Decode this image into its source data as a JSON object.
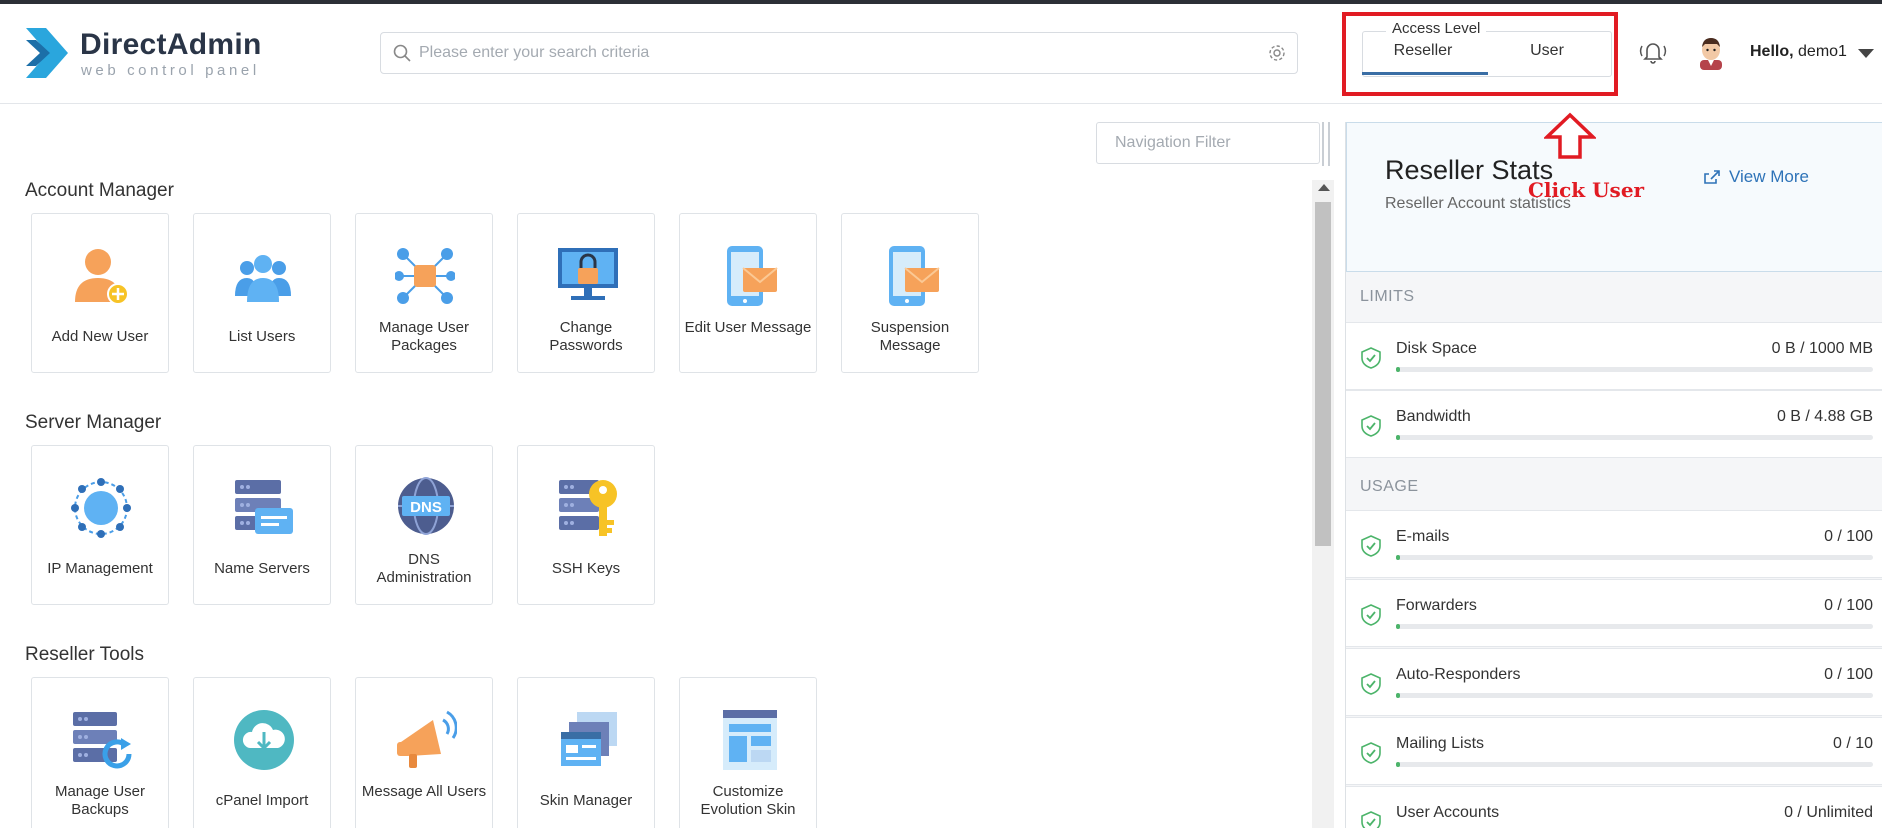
{
  "brand": {
    "name": "DirectAdmin",
    "tagline": "web control panel"
  },
  "search": {
    "placeholder": "Please enter your search criteria"
  },
  "access_level": {
    "label": "Access Level",
    "options": [
      "Reseller",
      "User"
    ],
    "selected": "Reseller"
  },
  "user_menu": {
    "greeting": "Hello,",
    "username": "demo1"
  },
  "nav_filter": {
    "placeholder": "Navigation Filter"
  },
  "sections": [
    {
      "title": "Account Manager",
      "items": [
        {
          "label": "Add New User",
          "icon": "add-user-icon"
        },
        {
          "label": "List Users",
          "icon": "list-users-icon"
        },
        {
          "label": "Manage User Packages",
          "icon": "packages-icon"
        },
        {
          "label": "Change Passwords",
          "icon": "change-password-icon"
        },
        {
          "label": "Edit User Message",
          "icon": "edit-message-icon"
        },
        {
          "label": "Suspension Message",
          "icon": "suspension-message-icon"
        }
      ]
    },
    {
      "title": "Server Manager",
      "items": [
        {
          "label": "IP Management",
          "icon": "ip-management-icon"
        },
        {
          "label": "Name Servers",
          "icon": "name-servers-icon"
        },
        {
          "label": "DNS Administration",
          "icon": "dns-icon",
          "icon_text": "DNS"
        },
        {
          "label": "SSH Keys",
          "icon": "ssh-keys-icon"
        }
      ]
    },
    {
      "title": "Reseller Tools",
      "items": [
        {
          "label": "Manage User Backups",
          "icon": "backups-icon"
        },
        {
          "label": "cPanel Import",
          "icon": "cpanel-import-icon"
        },
        {
          "label": "Message All Users",
          "icon": "megaphone-icon"
        },
        {
          "label": "Skin Manager",
          "icon": "skin-manager-icon"
        },
        {
          "label": "Customize Evolution Skin",
          "icon": "customize-skin-icon"
        }
      ]
    }
  ],
  "stats": {
    "title": "Reseller Stats",
    "subtitle": "Reseller Account statistics",
    "view_more": "View More",
    "limits_label": "LIMITS",
    "usage_label": "USAGE",
    "limits": [
      {
        "name": "Disk Space",
        "value": "0 B / 1000 MB",
        "fraction": 0.0
      },
      {
        "name": "Bandwidth",
        "value": "0 B / 4.88 GB",
        "fraction": 0.0
      }
    ],
    "usage": [
      {
        "name": "E-mails",
        "value": "0 / 100",
        "fraction": 0.0
      },
      {
        "name": "Forwarders",
        "value": "0 / 100",
        "fraction": 0.0
      },
      {
        "name": "Auto-Responders",
        "value": "0 / 100",
        "fraction": 0.0
      },
      {
        "name": "Mailing Lists",
        "value": "0 / 10",
        "fraction": 0.0
      },
      {
        "name": "User Accounts",
        "value": "0 / Unlimited",
        "fraction": 0.0
      }
    ]
  },
  "annotation": {
    "text": "Click User"
  },
  "colors": {
    "accent": "#3a6ea5",
    "annotation": "#e11b23",
    "progress": "#4cb46a",
    "link": "#2e73b8"
  }
}
